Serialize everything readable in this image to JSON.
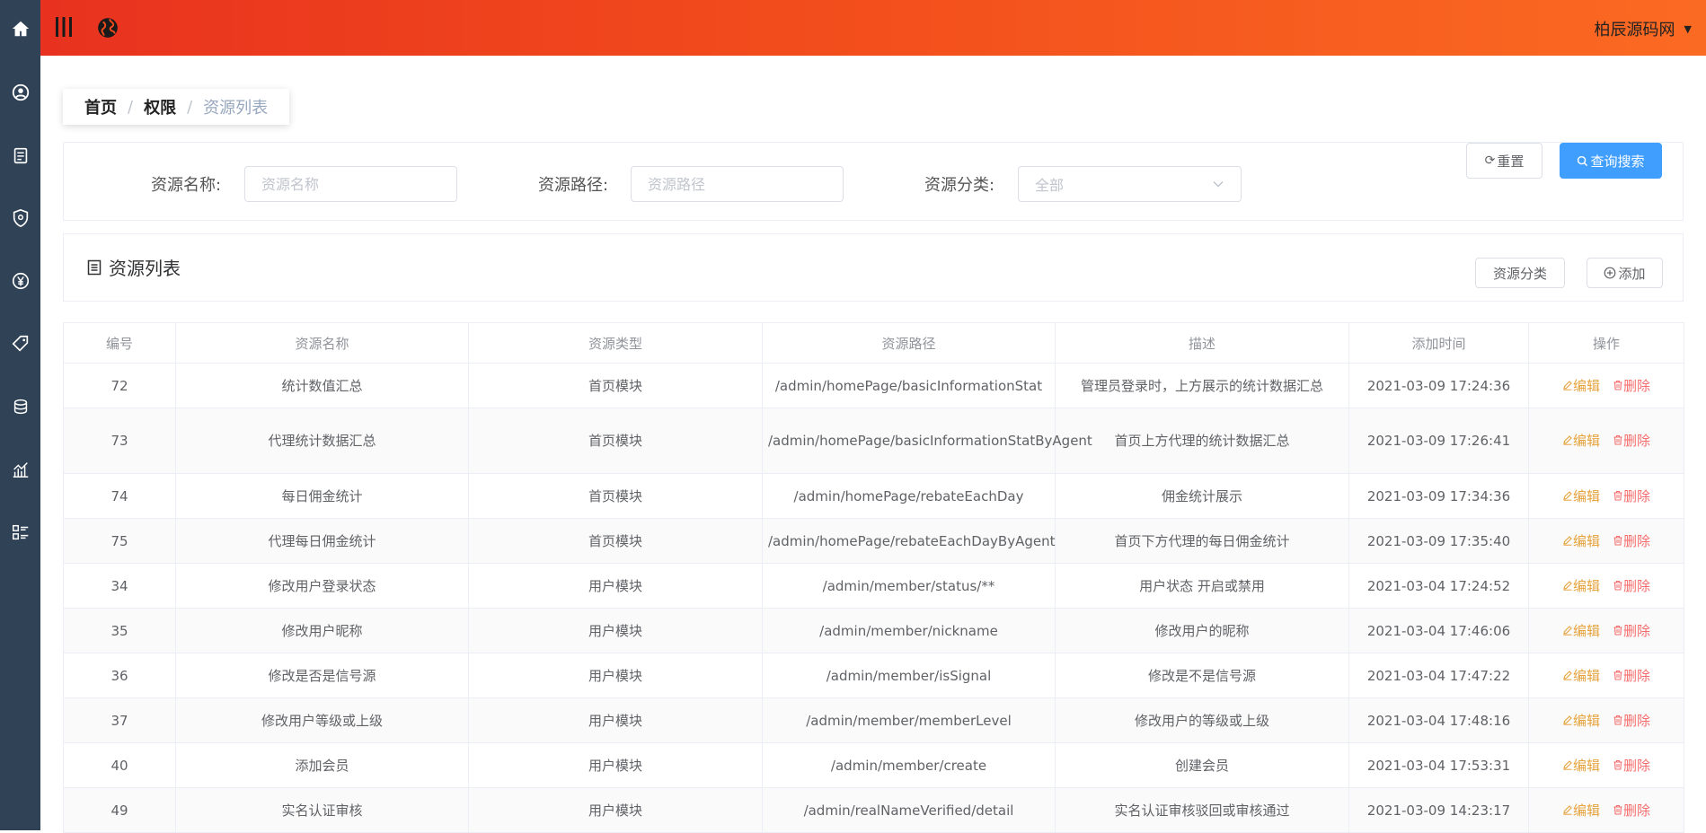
{
  "header": {
    "user_name": "柏辰源码网",
    "user_caret": "▼"
  },
  "icons": {
    "sidebar": [
      "home-icon",
      "user-circle-icon",
      "clipboard-icon",
      "shield-icon",
      "yen-icon",
      "tag-icon",
      "coins-icon",
      "chart-icon",
      "list-icon"
    ]
  },
  "breadcrumb": {
    "home": "首页",
    "separator": "/",
    "parent": "权限",
    "current": "资源列表"
  },
  "search": {
    "name_label": "资源名称:",
    "name_placeholder": "资源名称",
    "path_label": "资源路径:",
    "path_placeholder": "资源路径",
    "category_label": "资源分类:",
    "category_value": "全部",
    "reset_label": "重置",
    "search_label": "查询搜索"
  },
  "list": {
    "title": "资源列表",
    "category_button": "资源分类",
    "add_button": "添加"
  },
  "table": {
    "headers": [
      "编号",
      "资源名称",
      "资源类型",
      "资源路径",
      "描述",
      "添加时间",
      "操作"
    ],
    "edit_label": "编辑",
    "delete_label": "删除",
    "rows": [
      {
        "id": "72",
        "name": "统计数值汇总",
        "type": "首页模块",
        "path": "/admin/homePage/basicInformationStat",
        "desc": "管理员登录时，上方展示的统计数据汇总",
        "time": "2021-03-09 17:24:36"
      },
      {
        "id": "73",
        "name": "代理统计数据汇总",
        "type": "首页模块",
        "path": "/admin/homePage/basicInformationStatByAgent",
        "desc": "首页上方代理的统计数据汇总",
        "time": "2021-03-09 17:26:41"
      },
      {
        "id": "74",
        "name": "每日佣金统计",
        "type": "首页模块",
        "path": "/admin/homePage/rebateEachDay",
        "desc": "佣金统计展示",
        "time": "2021-03-09 17:34:36"
      },
      {
        "id": "75",
        "name": "代理每日佣金统计",
        "type": "首页模块",
        "path": "/admin/homePage/rebateEachDayByAgent",
        "desc": "首页下方代理的每日佣金统计",
        "time": "2021-03-09 17:35:40"
      },
      {
        "id": "34",
        "name": "修改用户登录状态",
        "type": "用户模块",
        "path": "/admin/member/status/**",
        "desc": "用户状态 开启或禁用",
        "time": "2021-03-04 17:24:52"
      },
      {
        "id": "35",
        "name": "修改用户昵称",
        "type": "用户模块",
        "path": "/admin/member/nickname",
        "desc": "修改用户的昵称",
        "time": "2021-03-04 17:46:06"
      },
      {
        "id": "36",
        "name": "修改是否是信号源",
        "type": "用户模块",
        "path": "/admin/member/isSignal",
        "desc": "修改是不是信号源",
        "time": "2021-03-04 17:47:22"
      },
      {
        "id": "37",
        "name": "修改用户等级或上级",
        "type": "用户模块",
        "path": "/admin/member/memberLevel",
        "desc": "修改用户的等级或上级",
        "time": "2021-03-04 17:48:16"
      },
      {
        "id": "40",
        "name": "添加会员",
        "type": "用户模块",
        "path": "/admin/member/create",
        "desc": "创建会员",
        "time": "2021-03-04 17:53:31"
      },
      {
        "id": "49",
        "name": "实名认证审核",
        "type": "用户模块",
        "path": "/admin/realNameVerified/detail",
        "desc": "实名认证审核驳回或审核通过",
        "time": "2021-03-09 14:23:17"
      }
    ]
  }
}
